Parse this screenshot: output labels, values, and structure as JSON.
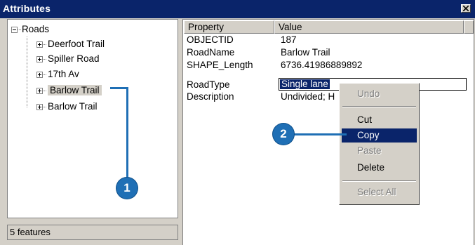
{
  "window": {
    "title": "Attributes",
    "close_icon": "close-x-icon"
  },
  "tree": {
    "root_label": "Roads",
    "items": [
      {
        "label": "Deerfoot Trail"
      },
      {
        "label": "Spiller Road"
      },
      {
        "label": "17th Av"
      },
      {
        "label": "Barlow Trail",
        "selected": true
      },
      {
        "label": "Barlow Trail"
      }
    ]
  },
  "status": {
    "text": "5 features"
  },
  "grid": {
    "headers": [
      "Property",
      "Value"
    ],
    "rows": [
      {
        "property": "OBJECTID",
        "value": "187"
      },
      {
        "property": "RoadName",
        "value": "Barlow Trail"
      },
      {
        "property": "SHAPE_Length",
        "value": "6736.41986889892"
      },
      {
        "property": "RoadType",
        "value": "Single lane"
      },
      {
        "property": "Description",
        "value": "Undivided; H"
      }
    ]
  },
  "context_menu": {
    "items": [
      {
        "label": "Undo",
        "enabled": false
      },
      {
        "label": "Cut",
        "enabled": true
      },
      {
        "label": "Copy",
        "enabled": true,
        "highlighted": true
      },
      {
        "label": "Paste",
        "enabled": false
      },
      {
        "label": "Delete",
        "enabled": true
      },
      {
        "label": "Select All",
        "enabled": false
      }
    ]
  },
  "callouts": [
    "1",
    "2"
  ],
  "colors": {
    "titlebar": "#0a246a",
    "selection": "#0a246a",
    "callout": "#1f6fb5",
    "face": "#d4d0c8"
  }
}
